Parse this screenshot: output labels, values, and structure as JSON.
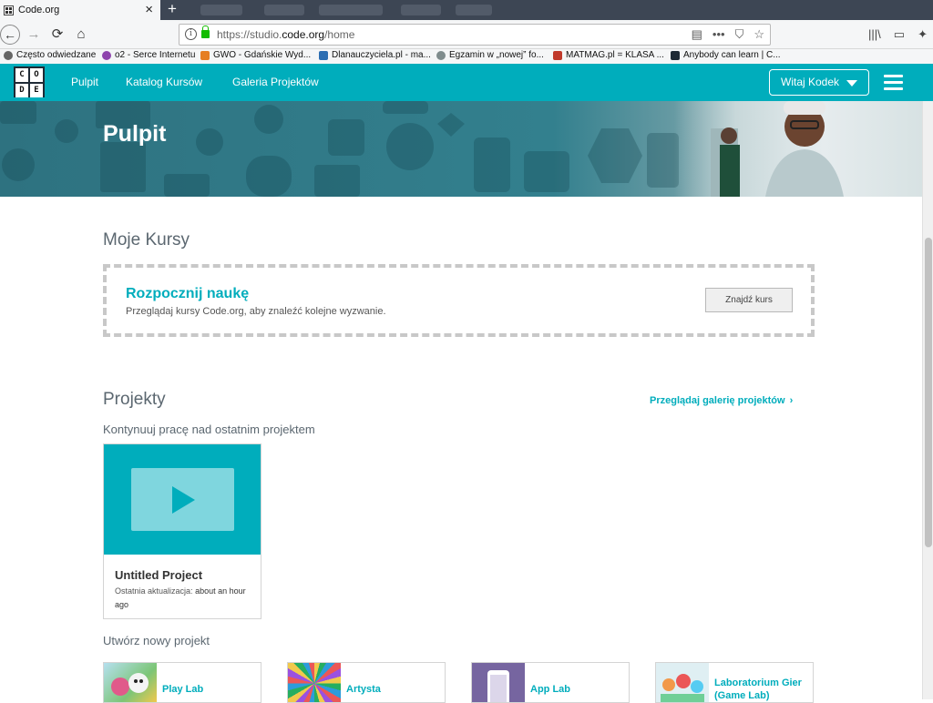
{
  "browser": {
    "tab_title": "Code.org",
    "tab_close": "×",
    "new_tab": "+",
    "url_scheme_host": "https://studio.",
    "url_domain": "code.org",
    "url_path": "/home",
    "back": "←",
    "forward": "→",
    "reload": "⟳",
    "home": "⌂",
    "url_tools": [
      "▤",
      "•••",
      "⛉",
      "☆"
    ],
    "right_tools": [
      "|||\\",
      "▭",
      "✦"
    ]
  },
  "bookmarks": [
    {
      "label": "Często odwiedzane",
      "color": "#555555"
    },
    {
      "label": "o2 - Serce Internetu",
      "color": "#8e44ad"
    },
    {
      "label": "GWO - Gdańskie Wyd...",
      "color": "#e67e22"
    },
    {
      "label": "Dlanauczyciela.pl - ma...",
      "color": "#2c6db2"
    },
    {
      "label": "Egzamin w „nowej” fo...",
      "color": "#7f8c8d"
    },
    {
      "label": "MATMAG.pl = KLASA ...",
      "color": "#c0392b"
    },
    {
      "label": "Anybody can learn | C...",
      "color": "#1e2a35"
    }
  ],
  "header": {
    "logo_letters": [
      "C",
      "O",
      "D",
      "E"
    ],
    "links": [
      "Pulpit",
      "Katalog Kursów",
      "Galeria Projektów"
    ],
    "user_button": "Witaj Kodek"
  },
  "banner": {
    "title": "Pulpit"
  },
  "courses": {
    "title": "Moje Kursy",
    "cta_title": "Rozpocznij naukę",
    "cta_desc": "Przeglądaj kursy Code.org, aby znaleźć kolejne wyzwanie.",
    "cta_button": "Znajdź kurs"
  },
  "projects": {
    "title": "Projekty",
    "gallery_link": "Przeglądaj galerię projektów",
    "gallery_chevron": "›",
    "continue_label": "Kontynuuj pracę nad ostatnim projektem",
    "recent": {
      "name": "Untitled Project",
      "meta_label": "Ostatnia aktualizacja:",
      "meta_value": "about an hour ago"
    },
    "create_label": "Utwórz nowy projekt",
    "new_types": [
      {
        "label": "Play Lab"
      },
      {
        "label": "Artysta"
      },
      {
        "label": "App Lab"
      },
      {
        "label": "Laboratorium Gier (Game Lab)"
      }
    ]
  },
  "colors": {
    "brand": "#00adbc",
    "brand_dark": "#1e2a35"
  }
}
